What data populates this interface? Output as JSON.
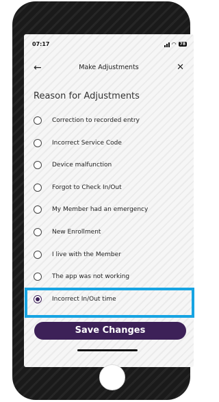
{
  "status_bar": {
    "time": "07:17",
    "battery": "78"
  },
  "header": {
    "title": "Make Adjustments"
  },
  "section": {
    "title": "Reason for Adjustments"
  },
  "reasons": [
    {
      "label": "Correction to recorded entry",
      "selected": false
    },
    {
      "label": "Incorrect Service Code",
      "selected": false
    },
    {
      "label": "Device malfunction",
      "selected": false
    },
    {
      "label": "Forgot to Check In/Out",
      "selected": false
    },
    {
      "label": "My Member had an emergency",
      "selected": false
    },
    {
      "label": "New Enrollment",
      "selected": false
    },
    {
      "label": "I live with the Member",
      "selected": false
    },
    {
      "label": "The app was not working",
      "selected": false
    },
    {
      "label": "Incorrect In/Out time",
      "selected": true
    }
  ],
  "save_button": {
    "label": "Save Changes"
  },
  "colors": {
    "primary": "#3d2158",
    "highlight": "#17a4e2"
  }
}
